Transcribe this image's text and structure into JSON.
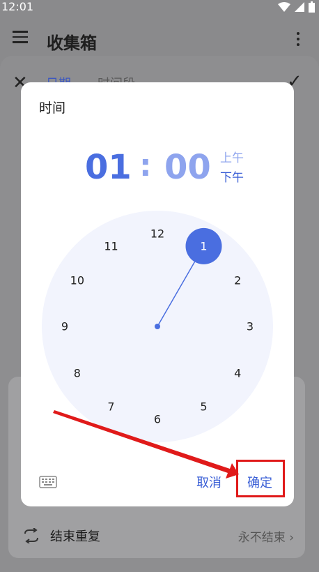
{
  "status_bar": {
    "time": "12:01"
  },
  "app_bar": {
    "title": "收集箱"
  },
  "sheet": {
    "tab_date": "日期",
    "tab_period": "时间段",
    "end_repeat_label": "结束重复",
    "end_repeat_value": "永不结束"
  },
  "dialog": {
    "title": "时间",
    "hour": "01",
    "separator": ":",
    "minute": "00",
    "am": "上午",
    "pm": "下午",
    "selected_hour": 1,
    "clock_numbers": [
      "12",
      "1",
      "2",
      "3",
      "4",
      "5",
      "6",
      "7",
      "8",
      "9",
      "10",
      "11"
    ],
    "cancel_label": "取消",
    "ok_label": "确定"
  },
  "colors": {
    "accent": "#3a5fd6",
    "selected_bubble": "#4a6ee0",
    "annotation": "#e01a1a"
  }
}
